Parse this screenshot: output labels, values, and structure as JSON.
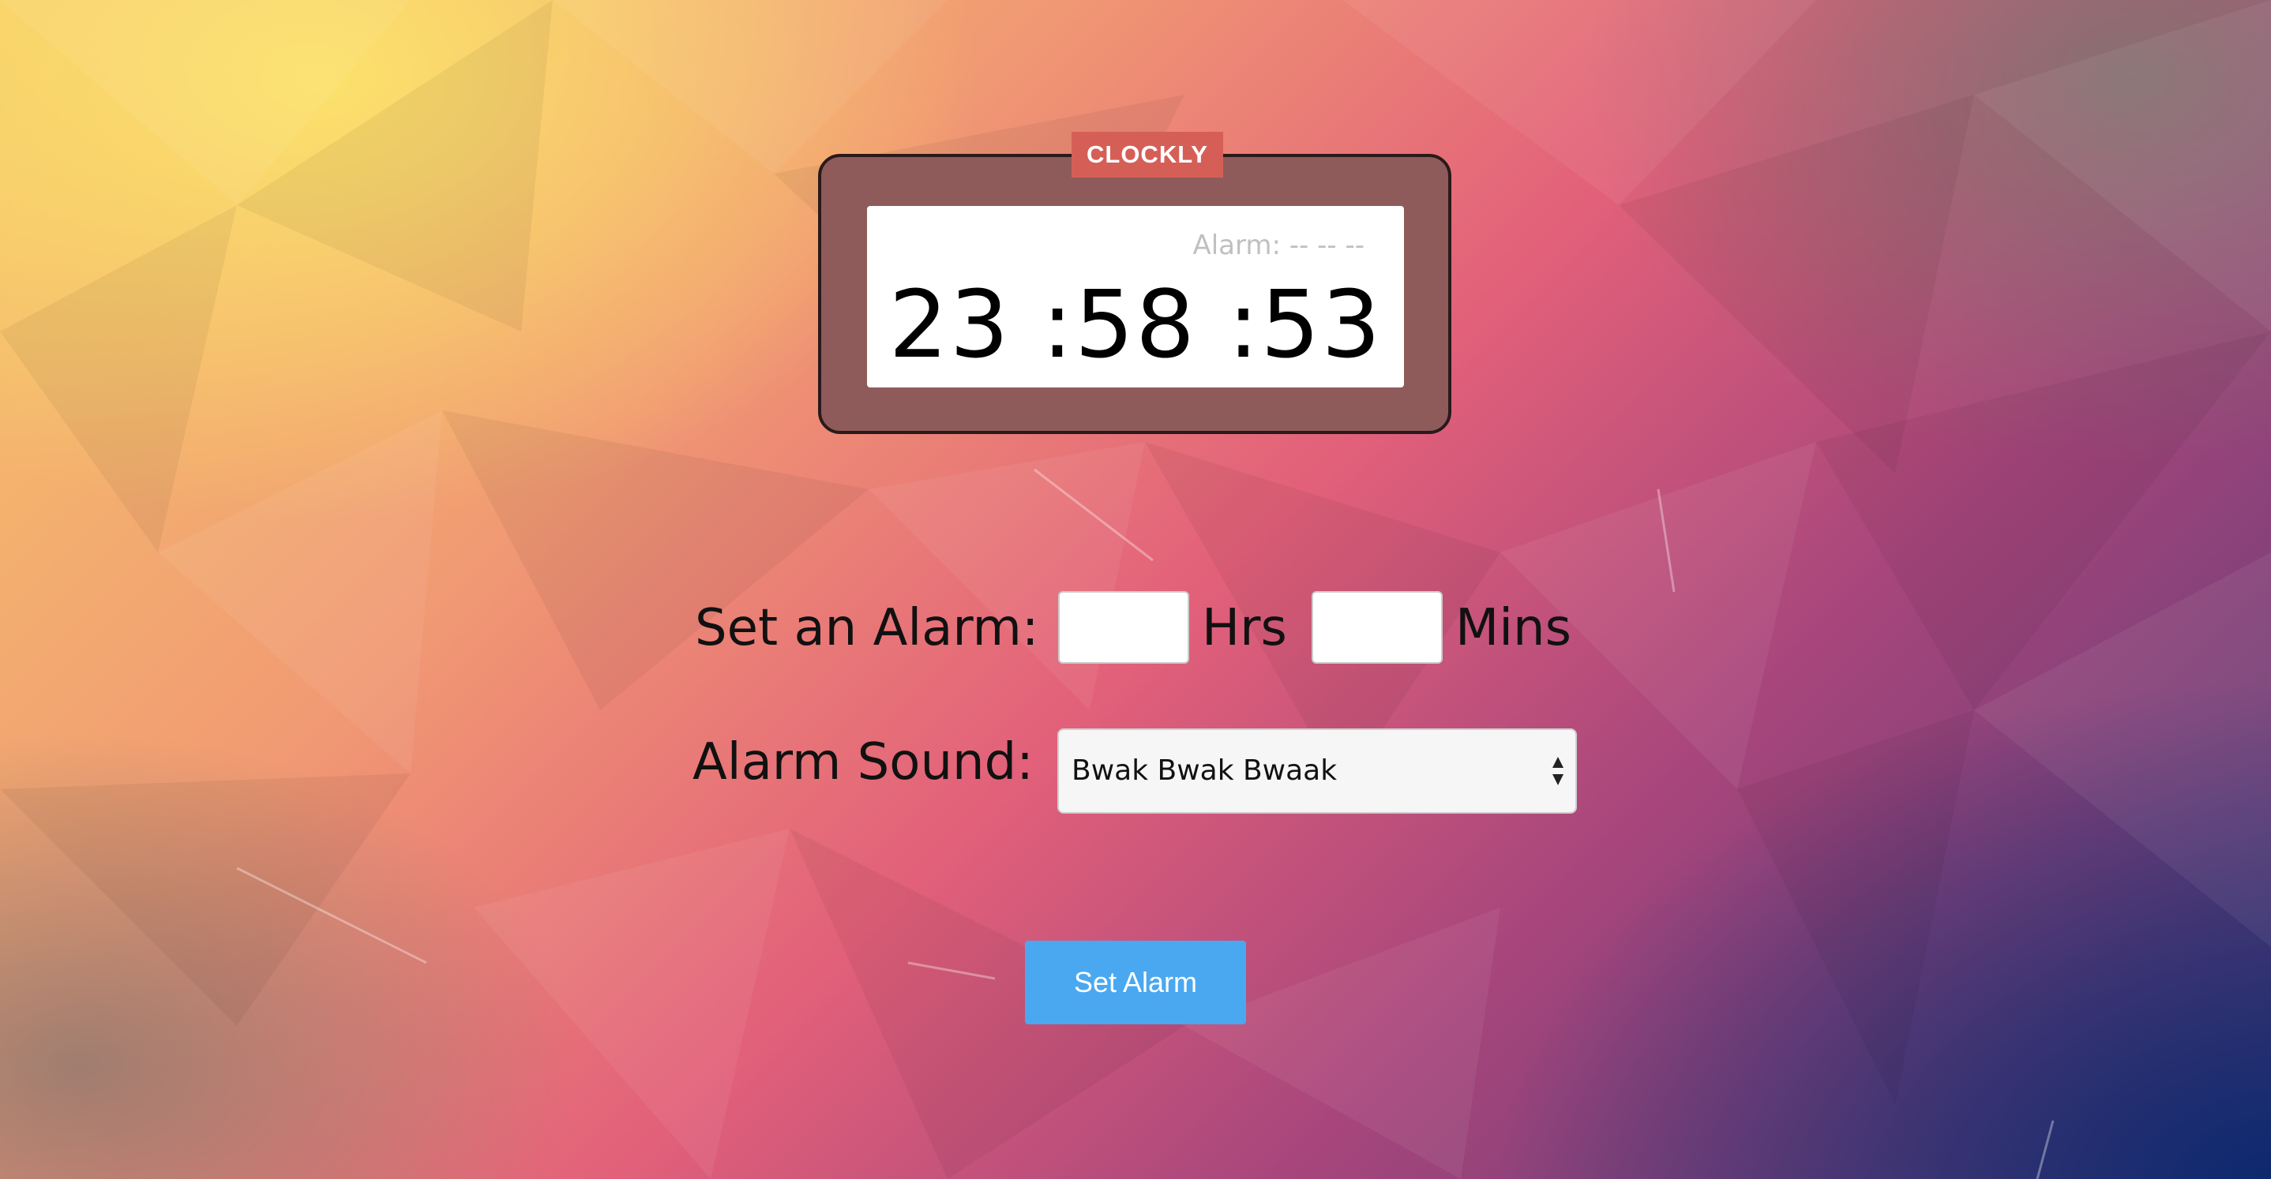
{
  "brand": "CLOCKLY",
  "clock": {
    "alarm_readout": "Alarm: -- -- --",
    "time": "23 :58 :53"
  },
  "alarm_form": {
    "set_label": "Set an Alarm:",
    "hours_value": "",
    "hours_unit": "Hrs",
    "minutes_value": "",
    "minutes_unit": "Mins",
    "sound_label": "Alarm Sound:",
    "sound_selected": "Bwak Bwak Bwaak",
    "submit_label": "Set Alarm"
  },
  "colors": {
    "clock_body": "#8f5a5a",
    "brand_badge": "#d55f57",
    "button": "#4aa8f0"
  },
  "icons": {
    "select_arrows": "up-down-arrows-icon"
  }
}
